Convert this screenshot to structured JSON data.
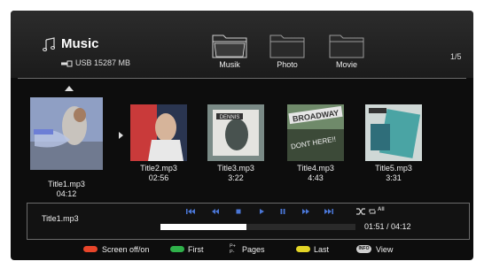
{
  "header": {
    "title": "Music",
    "storage": "USB 15287 MB",
    "page": "1/5"
  },
  "folders": [
    {
      "label": "Musik",
      "icon": "folder-icon",
      "selected": true
    },
    {
      "label": "Photo",
      "icon": "folder-icon",
      "selected": false
    },
    {
      "label": "Movie",
      "icon": "folder-icon",
      "selected": false
    }
  ],
  "tracks": [
    {
      "name": "Title1.mp3",
      "duration": "04:12",
      "selected": true
    },
    {
      "name": "Title2.mp3",
      "duration": "02:56"
    },
    {
      "name": "Title3.mp3",
      "duration": "3:22"
    },
    {
      "name": "Title4.mp3",
      "duration": "4:43"
    },
    {
      "name": "Title5.mp3",
      "duration": "3:31"
    }
  ],
  "album_art_text": {
    "art4_top": "BROADWAY",
    "art4_bottom": "DONT HERE!!",
    "art3": "DENNIS"
  },
  "player": {
    "now_playing": "Title1.mp3",
    "time": "01:51 / 04:12",
    "progress_fraction": 0.44,
    "controls": [
      "skip-to-start-icon",
      "rewind-icon",
      "stop-icon",
      "play-icon",
      "pause-icon",
      "fast-forward-icon",
      "skip-to-end-icon",
      "shuffle-icon",
      "repeat-all-icon"
    ],
    "repeat_label": "All"
  },
  "footer": {
    "screen_off": "Screen off/on",
    "first": "First",
    "pages": "Pages",
    "last": "Last",
    "view": "View",
    "info_key": "INFO",
    "colors": {
      "red": "#e8452a",
      "green": "#2fb14a",
      "yellow": "#e3d526"
    }
  },
  "colors": {
    "background": "#0d0d0d",
    "accent_blue": "#4a76d6"
  }
}
